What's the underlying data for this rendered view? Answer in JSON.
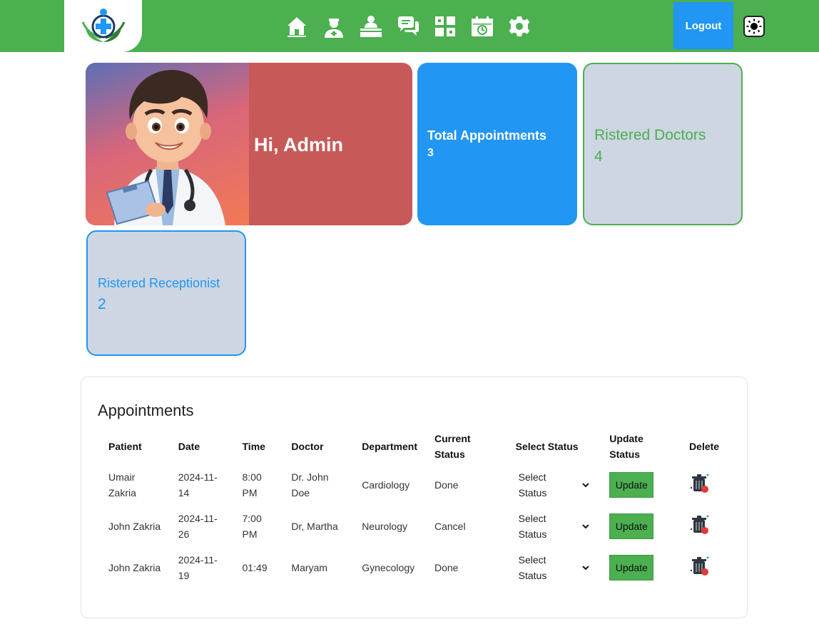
{
  "header": {
    "nav": [
      {
        "icon": "home-icon",
        "label": "Home"
      },
      {
        "icon": "doctor-icon",
        "label": "Doctors"
      },
      {
        "icon": "receptionist-icon",
        "label": "Receptionist"
      },
      {
        "icon": "chat-icon",
        "label": "Messages"
      },
      {
        "icon": "departments-icon",
        "label": "Departments"
      },
      {
        "icon": "calendar-icon",
        "label": "Appointments"
      },
      {
        "icon": "gear-icon",
        "label": "Settings"
      }
    ],
    "logout_label": "Logout",
    "theme_icon": "sun-icon"
  },
  "hero": {
    "greeting": "Hi, Admin"
  },
  "stats": {
    "total_appointments": {
      "label": "Total Appointments",
      "value": "3"
    },
    "doctors": {
      "label": "Ristered Doctors",
      "value": "4"
    },
    "receptionists": {
      "label": "Ristered Receptionist",
      "value": "2"
    }
  },
  "appointments": {
    "title": "Appointments",
    "columns": [
      "Patient",
      "Date",
      "Time",
      "Doctor",
      "Department",
      "Current Status",
      "Select Status",
      "Update Status",
      "Delete"
    ],
    "rows": [
      {
        "patient": "Umair Zakria",
        "date": "2024-11-14",
        "time": "8:00 PM",
        "doctor": "Dr. John Doe",
        "department": "Cardiology",
        "status": "Done",
        "select": "Select Status",
        "update": "Update"
      },
      {
        "patient": "John Zakria",
        "date": "2024-11-26",
        "time": "7:00 PM",
        "doctor": "Dr, Martha",
        "department": "Neurology",
        "status": "Cancel",
        "select": "Select Status",
        "update": "Update"
      },
      {
        "patient": "John Zakria",
        "date": "2024-11-19",
        "time": "01:49",
        "doctor": "Maryam",
        "department": "Gynecology",
        "status": "Done",
        "select": "Select Status",
        "update": "Update"
      }
    ]
  },
  "colors": {
    "primary_green": "#4caf50",
    "primary_blue": "#2196f3",
    "hero_red": "#c75a58",
    "card_gray": "#cdd6e2"
  }
}
